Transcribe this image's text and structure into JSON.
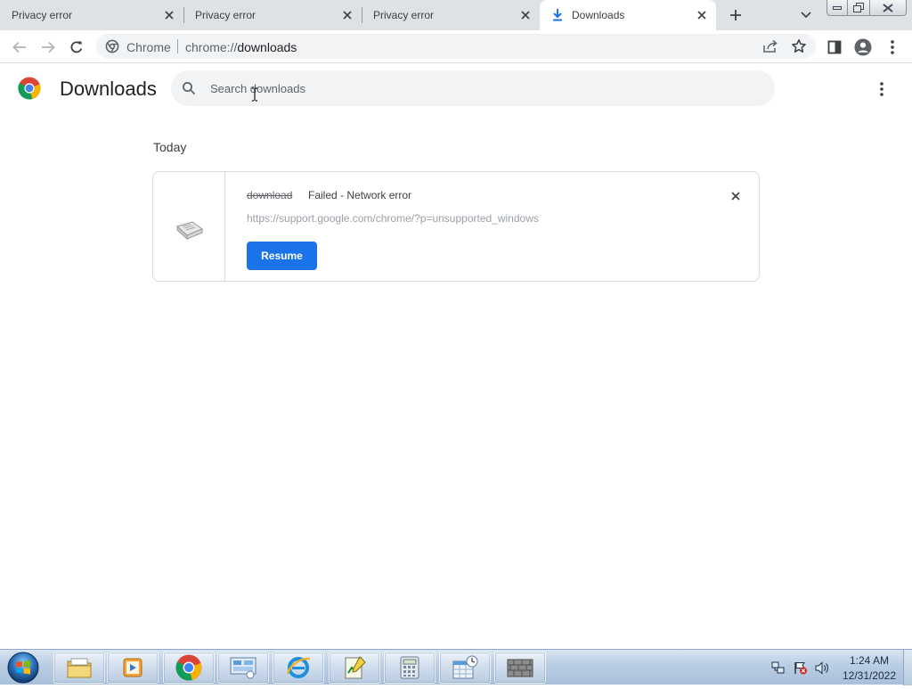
{
  "tabs": [
    {
      "title": "Privacy error",
      "active": false
    },
    {
      "title": "Privacy error",
      "active": false
    },
    {
      "title": "Privacy error",
      "active": false
    },
    {
      "title": "Downloads",
      "active": true
    }
  ],
  "omnibox": {
    "chip": "Chrome",
    "url_scheme": "chrome://",
    "url_host": "downloads"
  },
  "header": {
    "title": "Downloads",
    "search_placeholder": "Search downloads",
    "search_value": ""
  },
  "section": {
    "date_label": "Today"
  },
  "download": {
    "file_name": "download",
    "status": "Failed - Network error",
    "url": "https://support.google.com/chrome/?p=unsupported_windows",
    "resume_label": "Resume"
  },
  "taskbar": {
    "time": "1:24 AM",
    "date": "12/31/2022",
    "items": [
      "file-explorer-icon",
      "media-player-icon",
      "chrome-icon",
      "control-panel-icon",
      "internet-explorer-icon",
      "notepad-chart-icon",
      "calculator-icon",
      "scheduler-icon",
      "firewall-icon"
    ]
  },
  "colors": {
    "accent": "#1a73e8",
    "tabstrip": "#dee1e6",
    "omnibox_bg": "#f1f3f4"
  }
}
